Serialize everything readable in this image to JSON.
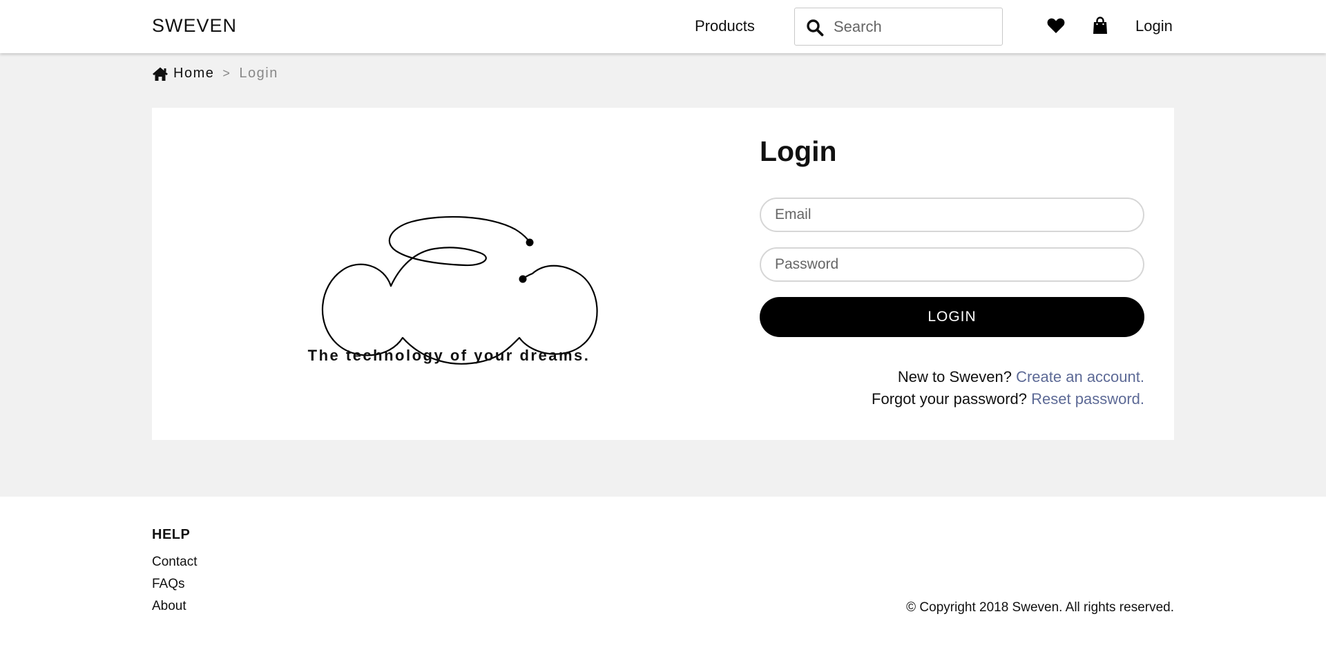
{
  "header": {
    "logo": "SWEVEN",
    "nav_products": "Products",
    "search_placeholder": "Search",
    "nav_login": "Login",
    "icons": [
      "search-icon",
      "heart-icon",
      "shopping-bag-icon"
    ]
  },
  "breadcrumb": {
    "home": "Home",
    "separator": ">",
    "current": "Login"
  },
  "hero": {
    "tagline": "The technology of your dreams."
  },
  "login_form": {
    "title": "Login",
    "email_placeholder": "Email",
    "password_placeholder": "Password",
    "button_label": "LOGIN",
    "new_prompt": "New to Sweven?",
    "create_account_link": "Create an account.",
    "forgot_prompt": "Forgot your password?",
    "reset_link": "Reset password."
  },
  "footer": {
    "heading": "HELP",
    "links": [
      "Contact",
      "FAQs",
      "About"
    ],
    "copyright": "© Copyright 2018 Sweven. All rights reserved."
  },
  "colors": {
    "background_gray": "#f1f1f1",
    "button_black": "#000000",
    "link_blue": "#5d6a96"
  }
}
